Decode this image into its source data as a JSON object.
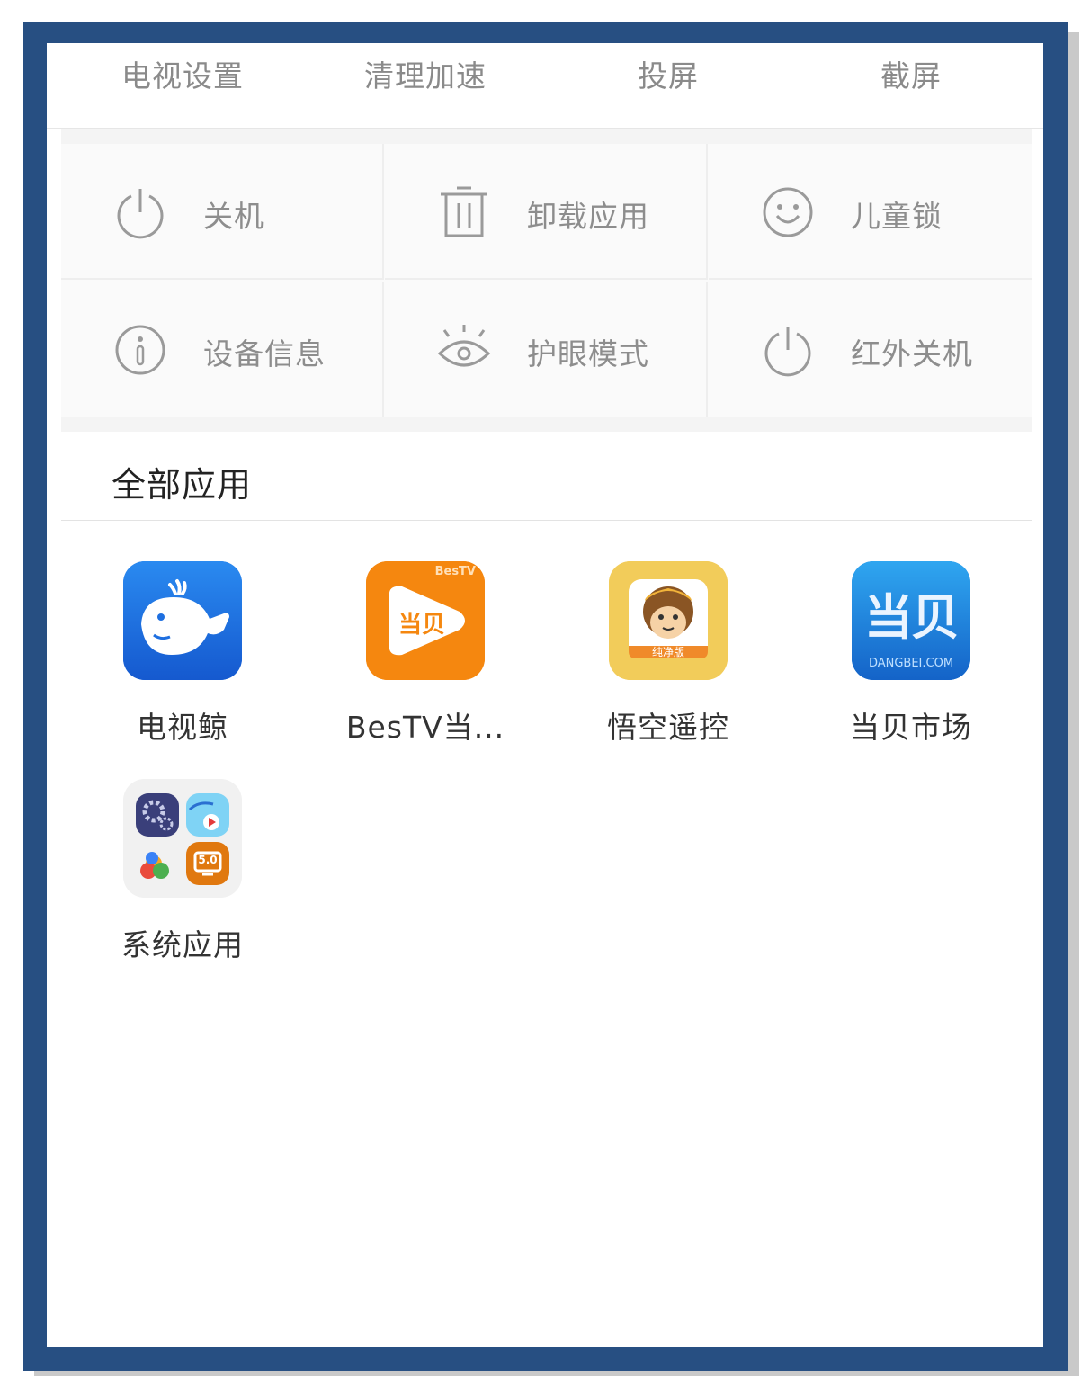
{
  "quickbar": {
    "items": [
      "电视设置",
      "清理加速",
      "投屏",
      "截屏"
    ]
  },
  "tools": {
    "items": [
      {
        "label": "关机",
        "icon": "power-icon"
      },
      {
        "label": "卸载应用",
        "icon": "trash-icon"
      },
      {
        "label": "儿童锁",
        "icon": "smiley-icon"
      },
      {
        "label": "设备信息",
        "icon": "info-icon"
      },
      {
        "label": "护眼模式",
        "icon": "eye-icon"
      },
      {
        "label": "红外关机",
        "icon": "power-icon"
      }
    ]
  },
  "apps_section": {
    "title": "全部应用",
    "apps": [
      {
        "name": "电视鲸",
        "icon": "whale-icon",
        "color": "#1e6fe0"
      },
      {
        "name": "BesTV当...",
        "icon": "bestv-icon",
        "color": "#f5870f",
        "icon_text": "当贝",
        "icon_badge": "BesTV"
      },
      {
        "name": "悟空遥控",
        "icon": "monkey-icon",
        "color": "#f2cc5a",
        "icon_badge": "纯净版"
      },
      {
        "name": "当贝市场",
        "icon": "dangbei-market-icon",
        "color": "#1a7fd9",
        "icon_text": "当贝",
        "icon_badge": "DANGBEI.COM"
      },
      {
        "name": "系统应用",
        "icon": "system-apps-folder-icon",
        "color": "#f1f1f1",
        "icon_badge": "5.0"
      }
    ]
  },
  "colors": {
    "frame": "#274f82",
    "muted_text": "#8d8d8d",
    "tool_bg": "#fafafa"
  }
}
